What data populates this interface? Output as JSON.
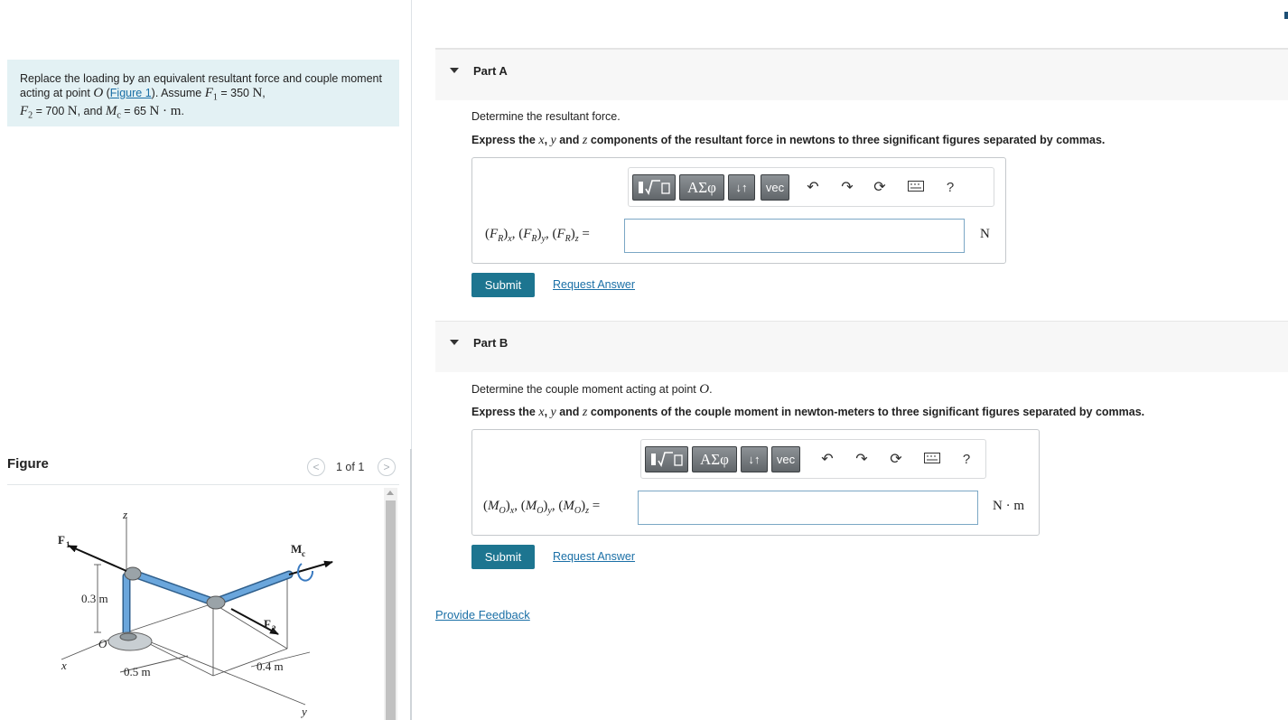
{
  "problem": {
    "text_before": "Replace the loading by an equivalent resultant force and couple moment acting at point ",
    "point": "O",
    "link_open": " (",
    "figure_link": "Figure 1",
    "link_close": "). Assume ",
    "F1_sym": "F",
    "F1_sub": "1",
    "F1_val": " = 350 ",
    "unit_N": "N",
    "sep1": ",",
    "F2_sym": "F",
    "F2_sub": "2",
    "F2_val": " = 700 ",
    "unit_N2": "N",
    "and_text": ", and ",
    "Mc_sym": "M",
    "Mc_sub": "c",
    "Mc_val": " = 65 ",
    "unit_Nm": "N · m",
    "end": "."
  },
  "figure_panel": {
    "title": "Figure",
    "pager_prev": "<",
    "pager_next": ">",
    "pager_count": "1 of 1",
    "labels": {
      "F1": "F",
      "F1_sub": "1",
      "z": "z",
      "Mc": "M",
      "Mc_sub": "c",
      "dim_03": "0.3 m",
      "F2": "F",
      "F2_sub": "2",
      "O": "O",
      "x": "x",
      "dim_05": "0.5 m",
      "dim_04": "0.4 m",
      "y": "y"
    }
  },
  "toolbar": {
    "greek": "ΑΣφ",
    "arrows": "↓↑",
    "vec": "vec",
    "undo_icon": "undo-icon",
    "redo_icon": "redo-icon",
    "reset_icon": "reset-icon",
    "keyboard_icon": "keyboard-icon",
    "help": "?"
  },
  "parts": [
    {
      "title": "Part A",
      "instruction": "Determine the resultant force.",
      "express_1": "Express the ",
      "var_x": "x",
      "comma1": ", ",
      "var_y": "y",
      "and1": " and ",
      "var_z": "z",
      "express_2": " components of the resultant force in newtons to three significant figures separated by commas.",
      "eq_sym": "F",
      "eq_sub": "R",
      "axes": [
        "x",
        "y",
        "z"
      ],
      "answer_value": "",
      "unit": "N",
      "submit": "Submit",
      "request": "Request Answer"
    },
    {
      "title": "Part B",
      "instruction": "Determine the couple moment acting at point ",
      "instruction_point": "O",
      "instruction_end": ".",
      "express_1": "Express the ",
      "var_x": "x",
      "comma1": ", ",
      "var_y": "y",
      "and1": " and ",
      "var_z": "z",
      "express_2": " components of the couple moment in newton-meters to three significant figures separated by commas.",
      "eq_sym": "M",
      "eq_sub": "O",
      "axes": [
        "x",
        "y",
        "z"
      ],
      "answer_value": "",
      "unit": "N · m",
      "submit": "Submit",
      "request": "Request Answer"
    }
  ],
  "feedback": "Provide Feedback",
  "colors": {
    "problem_bg": "#e3f1f4",
    "submit_bg": "#1d7590",
    "link": "#1a6fa6",
    "pipe": "#5f9bd1"
  }
}
